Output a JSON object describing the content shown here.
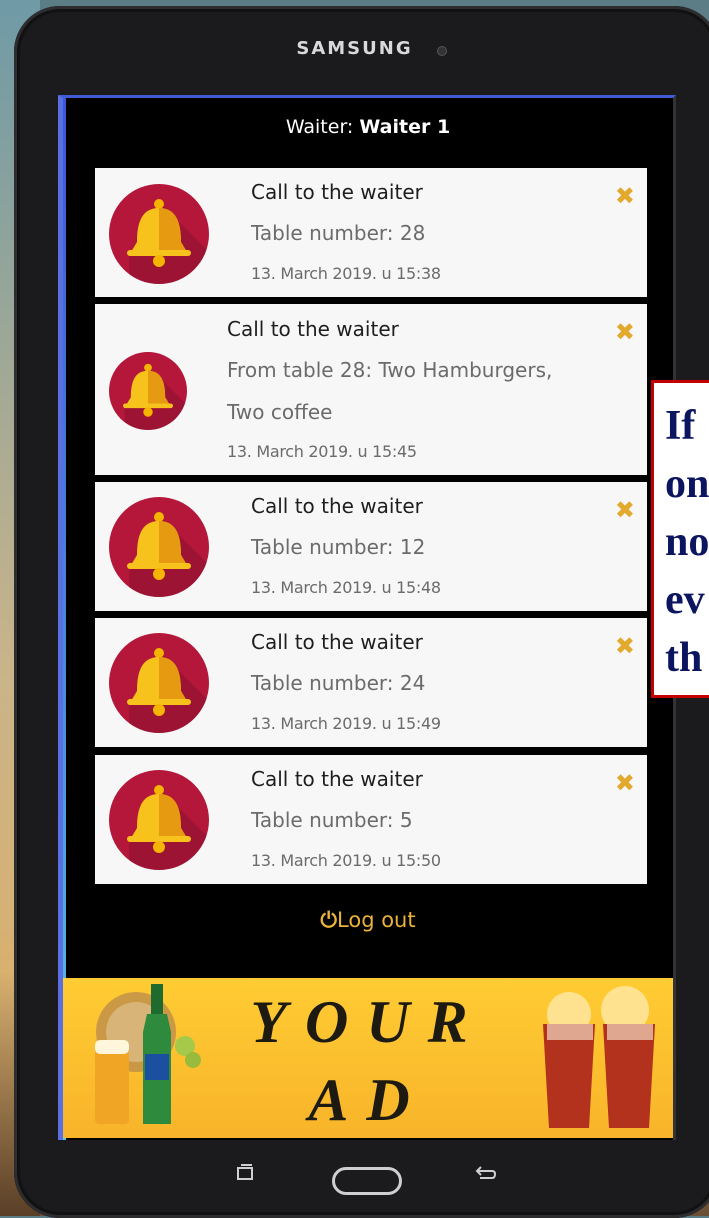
{
  "device": {
    "brand": "SAMSUNG"
  },
  "header": {
    "waiter_label": "Waiter: ",
    "waiter_name": "Waiter 1"
  },
  "notifications": [
    {
      "title": "Call to the waiter",
      "lines": [
        "Table number: 28"
      ],
      "time": "13. March 2019. u 15:38"
    },
    {
      "title": "Call to the waiter",
      "lines": [
        "From table 28: Two Hamburgers,",
        "Two coffee"
      ],
      "time": "13. March 2019. u 15:45"
    },
    {
      "title": "Call to the waiter",
      "lines": [
        "Table number: 12"
      ],
      "time": "13. March 2019. u 15:48"
    },
    {
      "title": "Call to the waiter",
      "lines": [
        "Table number: 24"
      ],
      "time": "13. March 2019. u 15:49"
    },
    {
      "title": "Call to the waiter",
      "lines": [
        "Table number: 5"
      ],
      "time": "13. March 2019. u 15:50"
    }
  ],
  "close_icon": "close-icon",
  "footer": {
    "logout_label": "Log out"
  },
  "ad": {
    "line1": "YOUR",
    "line2": "AD"
  },
  "callout": {
    "text": "If\non\nno\nev\nth"
  },
  "colors": {
    "accent": "#e2a92c",
    "bell_bg": "#b4173a",
    "ad_bg": "#ffcc33",
    "callout_border": "#c40000"
  }
}
